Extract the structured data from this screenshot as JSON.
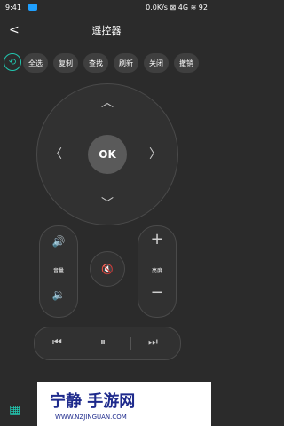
{
  "status": {
    "time": "9:41",
    "right": "0.0K/s ⊠ 4G ≋ 92"
  },
  "header": {
    "back": "<",
    "title": "遥控器"
  },
  "chips": [
    "全选",
    "复制",
    "查找",
    "刷新",
    "关闭",
    "撤销"
  ],
  "dpad": {
    "ok": "OK",
    "up": "︿",
    "down": "﹀",
    "left": "〈",
    "right": "〉"
  },
  "volume": {
    "label": "音量",
    "up_icon": "🔊",
    "down_icon": "🔉"
  },
  "brightness": {
    "label": "亮度",
    "plus": "+",
    "minus": "−"
  },
  "mute_icon": "🔇",
  "media": {
    "prev": "⏮",
    "pause": "⏸",
    "next": "⏭"
  },
  "watermark": {
    "title": "宁静 手游网",
    "sub": "WWW.NZJINGUAN.COM"
  },
  "colors": {
    "accent": "#22c7b0",
    "background": "#2b2b2b"
  },
  "bottom_icon": "grid-icon"
}
